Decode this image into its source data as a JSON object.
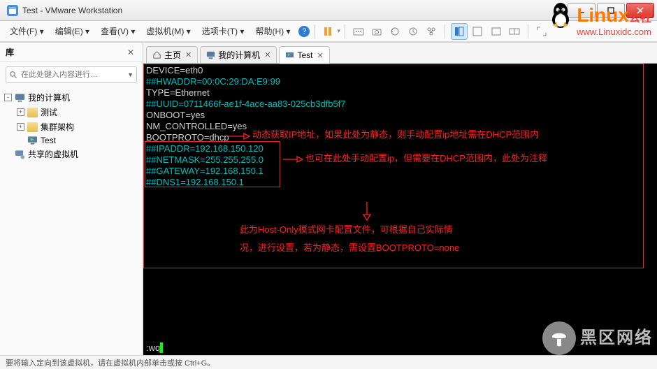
{
  "window": {
    "title": "Test - VMware Workstation"
  },
  "menu": {
    "file": "文件(F)",
    "edit": "编辑(E)",
    "view": "查看(V)",
    "vm": "虚拟机(M)",
    "tabs": "选项卡(T)",
    "help": "帮助(H)"
  },
  "sidebar": {
    "title": "库",
    "search_placeholder": "在此处键入内容进行…",
    "my_computer": "我的计算机",
    "folder_test": "测试",
    "folder_cluster": "集群架构",
    "item_test": "Test",
    "shared_vm": "共享的虚拟机"
  },
  "tabs": {
    "home": "主页",
    "my_computer": "我的计算机",
    "test": "Test"
  },
  "terminal": {
    "lines": [
      {
        "txt": "DEVICE=eth0",
        "cls": ""
      },
      {
        "txt": "##HWADDR=00:0C:29:DA:E9:99",
        "cls": "cyan"
      },
      {
        "txt": "TYPE=Ethernet",
        "cls": ""
      },
      {
        "txt": "##UUID=0711466f-ae1f-4ace-aa83-025cb3dfb5f7",
        "cls": "cyan"
      },
      {
        "txt": "ONBOOT=yes",
        "cls": ""
      },
      {
        "txt": "NM_CONTROLLED=yes",
        "cls": ""
      },
      {
        "txt": "BOOTPROTO=dhcp",
        "cls": ""
      },
      {
        "txt": "##IPADDR=192.168.150.120",
        "cls": "cyan"
      },
      {
        "txt": "##NETMASK=255.255.255.0",
        "cls": "cyan"
      },
      {
        "txt": "##GATEWAY=192.168.150.1",
        "cls": "cyan"
      },
      {
        "txt": "##DNS1=192.168.150.1",
        "cls": "cyan"
      }
    ],
    "cmd": ":wq",
    "note1": "动态获取IP地址，如果此处为静态，则手动配置ip地址需在DHCP范围内",
    "note2": "也可在此处手动配置ip，但需要在DHCP范围内，此处为注释",
    "note3a": "此为Host-Only模式网卡配置文件，可根据自己实际情",
    "note3b": "况，进行设置，若为静态，需设置BOOTPROTO=none"
  },
  "statusbar": {
    "text": "要将输入定向到该虚拟机，请在虚拟机内部单击或按 Ctrl+G。"
  },
  "watermark": {
    "linux_text": "Linux",
    "linux_sub": "公社",
    "linux_url": "www.Linuxidc.com",
    "heiqu": "黑区网络"
  }
}
